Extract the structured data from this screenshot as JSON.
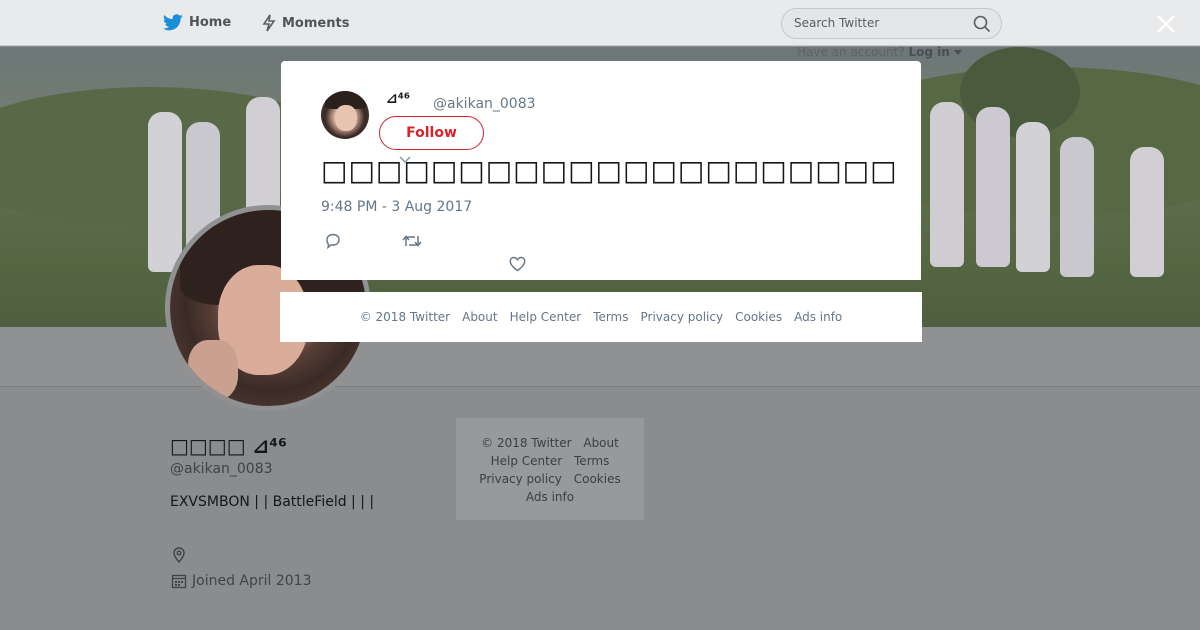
{
  "nav": {
    "home_label": "Home",
    "moments_label": "Moments",
    "search_placeholder": "Search Twitter",
    "account_prompt": "Have an account?",
    "login_label": "Log in"
  },
  "profile": {
    "name": "□□□□ ⊿⁴⁶",
    "handle": "@akikan_0083",
    "bio": "EXVSMBON |  | BattleField |  | |",
    "joined": "Joined April 2013"
  },
  "side_footer": {
    "items": [
      "© 2018 Twitter",
      "About",
      "Help Center",
      "Terms",
      "Privacy policy",
      "Cookies",
      "Ads info"
    ]
  },
  "tweet": {
    "author_name": "⊿⁴⁶",
    "author_handle": "@akikan_0083",
    "follow_label": "Follow",
    "text": "□□□□□□□□□□□□□□□□□□□□□",
    "timestamp": "9:48 PM - 3 Aug 2017"
  },
  "modal_footer": {
    "items": [
      "© 2018 Twitter",
      "About",
      "Help Center",
      "Terms",
      "Privacy policy",
      "Cookies",
      "Ads info"
    ]
  },
  "colors": {
    "follow_red": "#d8232b",
    "twitter_blue": "#1da1f2",
    "overlay_gray": "#8a8c8e"
  },
  "icons": [
    "twitter-bird-icon",
    "lightning-icon",
    "search-icon",
    "close-icon",
    "caret-down-icon",
    "location-icon",
    "calendar-icon",
    "reply-icon",
    "retweet-icon",
    "heart-icon"
  ]
}
